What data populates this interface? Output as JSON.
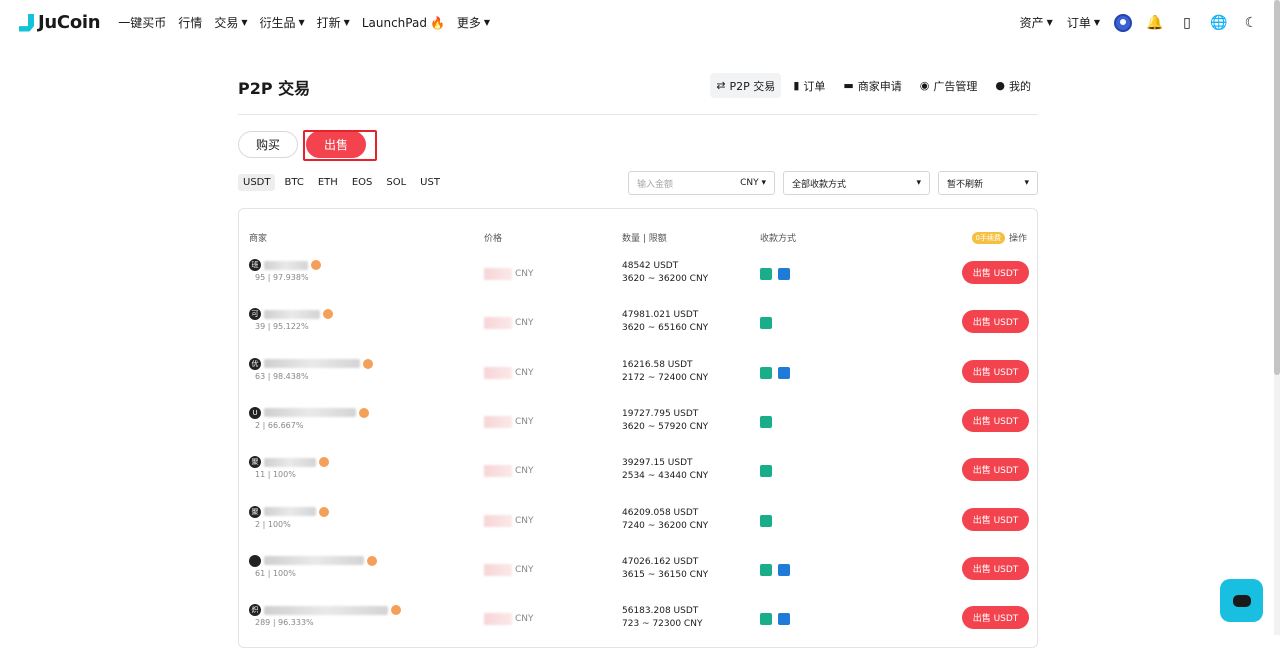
{
  "brand": {
    "name": "JuCoin"
  },
  "topnav": {
    "items": [
      {
        "label": "一键买币",
        "caret": false
      },
      {
        "label": "行情",
        "caret": false
      },
      {
        "label": "交易",
        "caret": true
      },
      {
        "label": "衍生品",
        "caret": true
      },
      {
        "label": "打新",
        "caret": true
      },
      {
        "label": "LaunchPad",
        "caret": false,
        "flame": true
      },
      {
        "label": "更多",
        "caret": true
      }
    ],
    "right": [
      {
        "label": "资产"
      },
      {
        "label": "订单"
      }
    ]
  },
  "page": {
    "title": "P2P 交易",
    "subnav": [
      "P2P 交易",
      "订单",
      "商家申请",
      "广告管理",
      "我的"
    ],
    "toggle": {
      "buy": "购买",
      "sell": "出售"
    },
    "coins": [
      "USDT",
      "BTC",
      "ETH",
      "EOS",
      "SOL",
      "UST"
    ],
    "filters": {
      "amount_placeholder": "输入金额",
      "currency": "CNY",
      "payment": "全部收款方式",
      "refresh": "暂不刷新"
    }
  },
  "table": {
    "headers": {
      "merchant": "商家",
      "price": "价格",
      "qty": "数量 | 限额",
      "pay": "收款方式",
      "op": "操作",
      "op_badge": "0手续费"
    },
    "currency": "CNY",
    "button_label": "出售 USDT",
    "rows": [
      {
        "avatar": "班",
        "stats": "95 | 97.938%",
        "qty": "48542 USDT",
        "limit": "3620 ~ 36200 CNY",
        "pay": [
          "wechat",
          "alipay"
        ],
        "blur_w": 44
      },
      {
        "avatar": "可",
        "stats": "39 | 95.122%",
        "qty": "47981.021 USDT",
        "limit": "3620 ~ 65160 CNY",
        "pay": [
          "wechat"
        ],
        "blur_w": 56
      },
      {
        "avatar": "优",
        "stats": "63 | 98.438%",
        "qty": "16216.58 USDT",
        "limit": "2172 ~ 72400 CNY",
        "pay": [
          "wechat",
          "alipay"
        ],
        "blur_w": 96
      },
      {
        "avatar": "U",
        "stats": "2 | 66.667%",
        "qty": "19727.795 USDT",
        "limit": "3620 ~ 57920 CNY",
        "pay": [
          "wechat"
        ],
        "blur_w": 92
      },
      {
        "avatar": "聚",
        "stats": "11 | 100%",
        "qty": "39297.15 USDT",
        "limit": "2534 ~ 43440 CNY",
        "pay": [
          "wechat"
        ],
        "blur_w": 52
      },
      {
        "avatar": "聚",
        "stats": "2 | 100%",
        "qty": "46209.058 USDT",
        "limit": "7240 ~ 36200 CNY",
        "pay": [
          "wechat"
        ],
        "blur_w": 52
      },
      {
        "avatar": "",
        "stats": "61 | 100%",
        "qty": "47026.162 USDT",
        "limit": "3615 ~ 36150 CNY",
        "pay": [
          "wechat",
          "alipay"
        ],
        "blur_w": 100
      },
      {
        "avatar": "炽",
        "stats": "289 | 96.333%",
        "qty": "56183.208 USDT",
        "limit": "723 ~ 72300 CNY",
        "pay": [
          "wechat",
          "alipay"
        ],
        "blur_w": 124
      }
    ]
  }
}
